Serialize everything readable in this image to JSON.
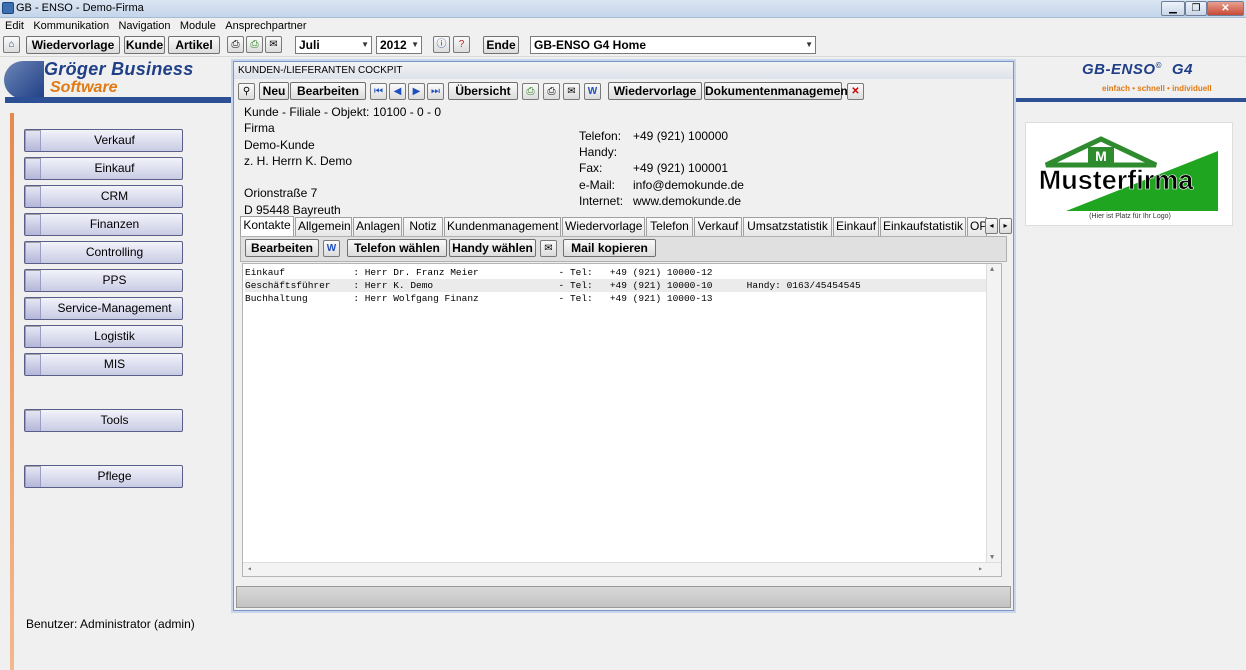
{
  "window": {
    "title": "GB - ENSO  -  Demo-Firma"
  },
  "menu": [
    "Edit",
    "Kommunikation",
    "Navigation",
    "Module",
    "Ansprechpartner"
  ],
  "toolbar": {
    "wiedervorlage": "Wiedervorlage",
    "kunde": "Kunde",
    "artikel": "Artikel",
    "month": "Juli",
    "year": "2012",
    "ende": "Ende",
    "home_select": "GB-ENSO G4 Home"
  },
  "branding": {
    "left_line1": "Gröger Business",
    "left_line2": "Software",
    "right_title": "GB-ENSO",
    "right_copy": "©",
    "right_g4": "G4",
    "slogan": "einfach • schnell • individuell",
    "logo_name": "Musterfirma",
    "logo_letter": "M",
    "logo_hint": "(Hier ist Platz für Ihr Logo)"
  },
  "nav": [
    "Verkauf",
    "Einkauf",
    "CRM",
    "Finanzen",
    "Controlling",
    "PPS",
    "Service-Management",
    "Logistik",
    "MIS",
    "Tools",
    "Pflege"
  ],
  "user": "Benutzer: Administrator (admin)",
  "cockpit": {
    "title": "KUNDEN-/LIEFERANTEN COCKPIT",
    "buttons": {
      "neu": "Neu",
      "bearbeiten": "Bearbeiten",
      "uebersicht": "Übersicht",
      "wiedervorlage": "Wiedervorlage",
      "dokumente": "Dokumentenmanagement"
    },
    "kunde_label": "Kunde - Filiale - Objekt:",
    "kunde_value": "10100 - 0 - 0",
    "address": [
      "Firma",
      "Demo-Kunde",
      "z. H. Herrn K. Demo",
      "",
      "Orionstraße 7",
      "D 95448 Bayreuth"
    ],
    "contact": [
      {
        "label": "Telefon:",
        "value": "+49 (921) 100000"
      },
      {
        "label": "Handy:",
        "value": ""
      },
      {
        "label": "Fax:",
        "value": "+49 (921) 100001"
      },
      {
        "label": "e-Mail:",
        "value": "info@demokunde.de"
      },
      {
        "label": "Internet:",
        "value": "www.demokunde.de"
      }
    ],
    "tabs": [
      "Kontakte",
      "Allgemein",
      "Anlagen",
      "Notiz",
      "Kundenmanagement",
      "Wiedervorlage",
      "Telefon",
      "Verkauf",
      "Umsatzstatistik",
      "Einkauf",
      "Einkaufstatistik",
      "OP"
    ],
    "sub_buttons": {
      "bearbeiten": "Bearbeiten",
      "telefon": "Telefon wählen",
      "handy": "Handy wählen",
      "mail": "Mail kopieren"
    },
    "rows": [
      "Einkauf            : Herr Dr. Franz Meier              - Tel:   +49 (921) 10000-12",
      "Geschäftsführer    : Herr K. Demo                      - Tel:   +49 (921) 10000-10      Handy: 0163/45454545",
      "Buchhaltung        : Herr Wolfgang Finanz              - Tel:   +49 (921) 10000-13"
    ]
  }
}
